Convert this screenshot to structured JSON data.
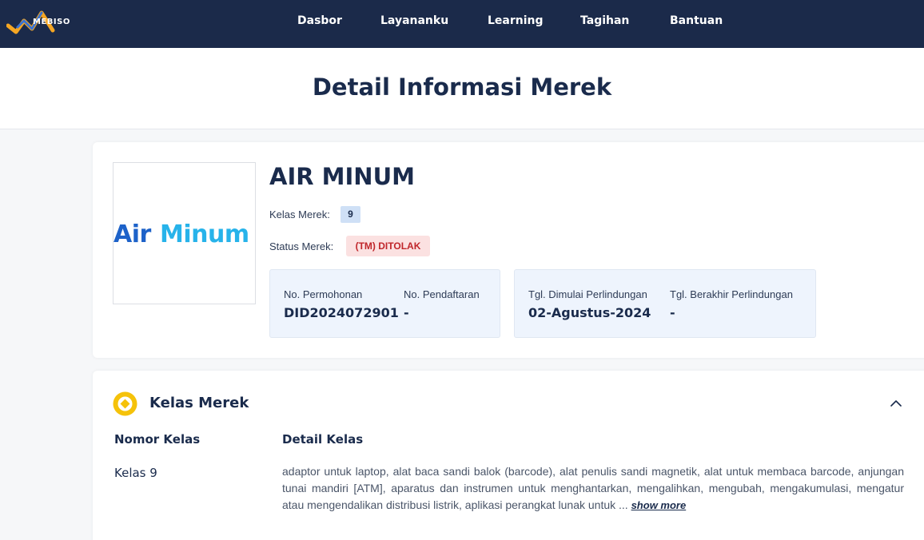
{
  "app": {
    "logo_text": "MEBISO",
    "colors": {
      "nav_bg": "#1b2a4a",
      "accent_blue": "#1d62c9",
      "accent_cyan": "#27b3ea",
      "danger": "#c0262b",
      "gold": "#f5c20a"
    }
  },
  "nav": {
    "items": [
      {
        "label": "Dasbor"
      },
      {
        "label": "Layananku"
      },
      {
        "label": "Learning"
      },
      {
        "label": "Tagihan"
      },
      {
        "label": "Bantuan"
      }
    ]
  },
  "page": {
    "title": "Detail Informasi Merek"
  },
  "brand": {
    "logo_word1": "Air",
    "logo_word2": "Minum",
    "name": "AIR MINUM",
    "class_label": "Kelas Merek:",
    "class_value": "9",
    "status_label": "Status Merek:",
    "status_value": "(TM) DITOLAK",
    "registration": {
      "application_no_label": "No. Permohonan",
      "application_no": "DID2024072901",
      "registration_no_label": "No. Pendaftaran",
      "registration_no": "-"
    },
    "protection": {
      "start_label": "Tgl. Dimulai Perlindungan",
      "start_value": "02-Agustus-2024",
      "end_label": "Tgl. Berakhir Perlindungan",
      "end_value": "-"
    }
  },
  "classes_section": {
    "icon": "coin-icon",
    "title": "Kelas Merek",
    "col_number": "Nomor Kelas",
    "col_detail": "Detail Kelas",
    "rows": [
      {
        "number": "Kelas 9",
        "detail": "adaptor untuk laptop, alat baca sandi balok (barcode), alat penulis sandi magnetik, alat untuk membaca barcode, anjungan tunai mandiri [ATM], aparatus dan instrumen untuk menghantarkan, mengalihkan, mengubah, mengakumulasi, mengatur atau mengendalikan distribusi listrik, aplikasi perangkat lunak untuk ...",
        "show_more": "show more"
      }
    ]
  }
}
